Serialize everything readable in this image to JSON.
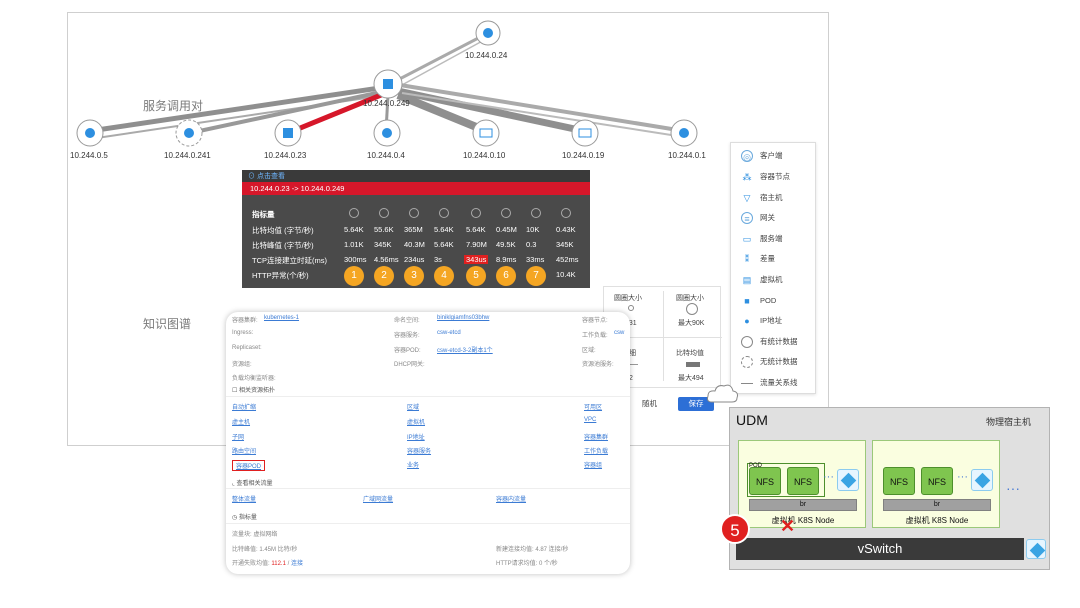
{
  "graph": {
    "annotation_service": "服务调用对",
    "annotation_kg": "知识图谱",
    "nodes": {
      "top": "10.244.0.24",
      "center": "10.244.0.249",
      "n1": "10.244.0.5",
      "n2": "10.244.0.241",
      "n3": "10.244.0.23",
      "n4": "10.244.0.4",
      "n5": "10.244.0.10",
      "n6": "10.244.0.19",
      "n7": "10.244.0.1"
    }
  },
  "tooltip": {
    "header": "点击查看",
    "route": "10.244.0.23 -> 10.244.0.249",
    "metric_header": "指标量",
    "rows": [
      {
        "label": "比特均值 (字节/秒)",
        "values": [
          "5.64K",
          "55.6K",
          "365M",
          "5.64K",
          "5.64K",
          "0.45M",
          "10K",
          "0.43K"
        ]
      },
      {
        "label": "比特峰值 (字节/秒)",
        "values": [
          "1.01K",
          "345K",
          "40.3M",
          "5.64K",
          "7.90M",
          "49.5K",
          "0.3",
          "345K"
        ]
      },
      {
        "label": "TCP连接建立时延(ms)",
        "values": [
          "300ms",
          "4.56ms",
          "234us",
          "3s",
          "343us",
          "8.9ms",
          "33ms",
          "452ms"
        ]
      },
      {
        "label": "HTTP异常(个/秒)",
        "values": [
          "1",
          "2",
          "3",
          "4",
          "5",
          "6",
          "7",
          "10.4K"
        ]
      }
    ]
  },
  "legend": {
    "items": [
      {
        "label": "客户端",
        "icon": "client-icon"
      },
      {
        "label": "容器节点",
        "icon": "container-node-icon"
      },
      {
        "label": "宿主机",
        "icon": "host-icon"
      },
      {
        "label": "网关",
        "icon": "gateway-icon"
      },
      {
        "label": "服务端",
        "icon": "server-icon"
      },
      {
        "label": "差量",
        "icon": "delta-icon"
      },
      {
        "label": "虚拟机",
        "icon": "vm-icon"
      },
      {
        "label": "POD",
        "icon": "pod-icon"
      },
      {
        "label": "IP地址",
        "icon": "ip-icon"
      },
      {
        "label": "有统计数据",
        "icon": "has-stats-icon"
      },
      {
        "label": "无统计数据",
        "icon": "no-stats-icon"
      },
      {
        "label": "流量关系线",
        "icon": "flow-line-icon"
      }
    ]
  },
  "size_panel": {
    "circle_size": "圆圈大小",
    "circle_size2": "圆圈大小",
    "min_label": "小831",
    "max_label": "最大90K",
    "thickness": "粗细",
    "bitrate": "比特均值",
    "min2": "小2",
    "max2": "最大494",
    "random_button": "随机",
    "save_button": "保存"
  },
  "detail": {
    "container_group_label": "容器集群:",
    "container_group_value": "kubernetes-1",
    "namespace_label": "命名空间:",
    "namespace_value": "biniklgiamfns03bhw",
    "container_node_label": "容器节点:",
    "ingress_label": "Ingress:",
    "service_label": "容器服务:",
    "service_value": "csw-etcd",
    "workload_label": "工作负载:",
    "workload_value": "csw",
    "replicaset_label": "Replicaset:",
    "pod_label": "容器POD:",
    "pod_value": "csw-etcd-3-2副本1个",
    "zone_label": "区域:",
    "resource_group_label": "资源组:",
    "dhcp_label": "DHCP网关:",
    "resource_pool_label": "资源池服务:",
    "lb_label": "负载均衡监听器:",
    "related_resources": "相关资源拓扑",
    "links_col1": [
      "自动扩缩",
      "虚主机",
      "子网",
      "路由空间",
      "容器POD"
    ],
    "links_col2": [
      "区域",
      "虚拟机",
      "IP地址",
      "容器服务",
      "业务"
    ],
    "links_col3": [
      "可用区",
      "VPC",
      "容器集群",
      "工作负载",
      "容器组"
    ],
    "related_traffic": "查看相关流量",
    "traffic_links": [
      "整体流量",
      "广域网流量",
      "容器内流量"
    ],
    "metric_title": "指标量",
    "metric_stat": "流量块: 虚拟网络",
    "bit_avg_label": "比特峰值: 1.45M 比特/秒",
    "new_conn_label": "新建连接均值: 4.87 连接/秒",
    "tcp_fail_prefix": "开通失败均值: ",
    "tcp_fail_value": "112.1",
    "tcp_fail_link": "连接",
    "http_label": "HTTP请求均值: 0 个/秒"
  },
  "udm": {
    "title": "UDM",
    "physical_host": "物理宿主机",
    "pod_label": "POD",
    "nfs": "NFS",
    "br": "br",
    "node_label": "虚拟机 K8S Node",
    "vswitch": "vSwitch",
    "ellipsis": "···",
    "step_number": "5"
  }
}
